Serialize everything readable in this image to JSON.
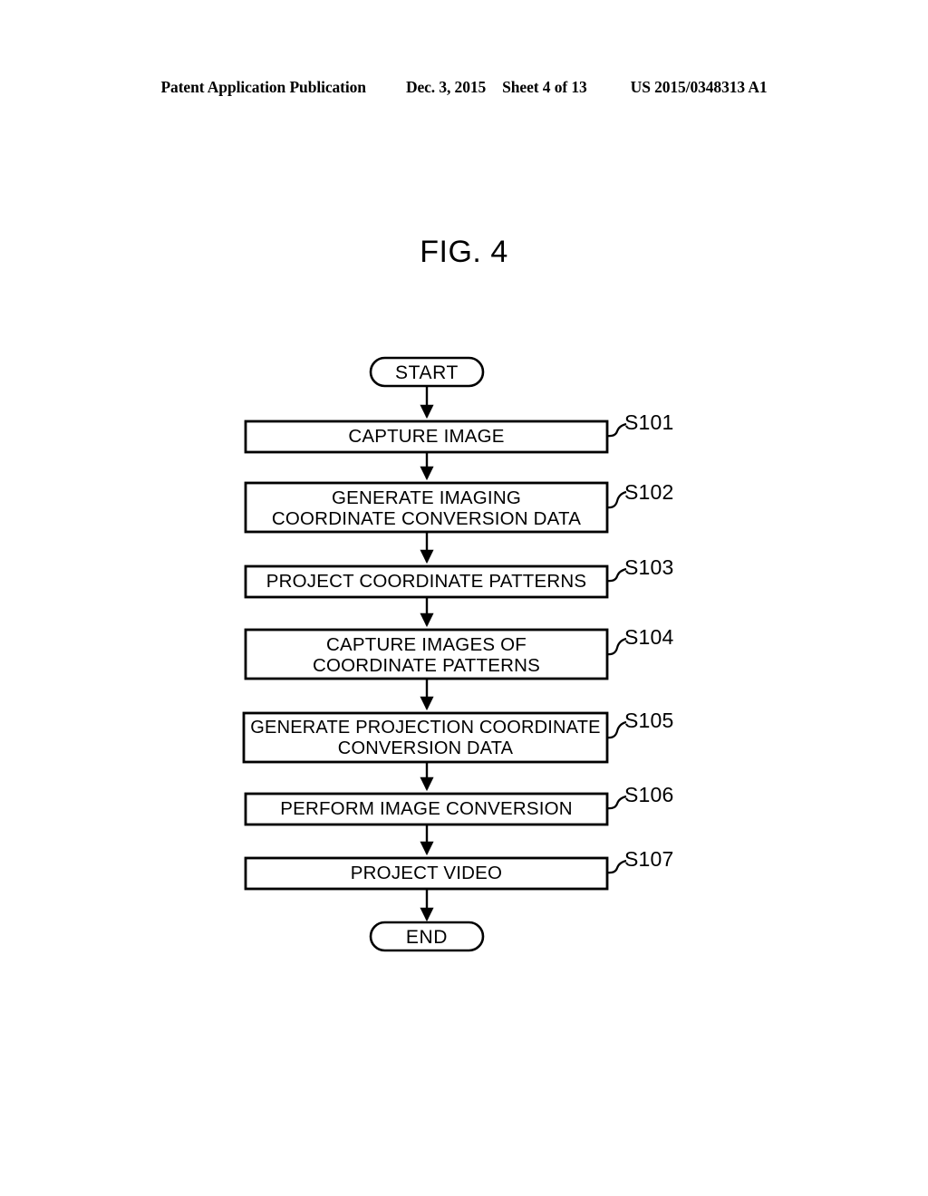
{
  "header": {
    "publication": "Patent Application Publication",
    "date": "Dec. 3, 2015",
    "sheet": "Sheet 4 of 13",
    "patent_number": "US 2015/0348313 A1"
  },
  "figure": {
    "title": "FIG. 4"
  },
  "flowchart": {
    "start_label": "START",
    "end_label": "END",
    "nodes": [
      {
        "ref": "S101",
        "lines": [
          "CAPTURE IMAGE"
        ]
      },
      {
        "ref": "S102",
        "lines": [
          "GENERATE IMAGING",
          "COORDINATE CONVERSION DATA"
        ]
      },
      {
        "ref": "S103",
        "lines": [
          "PROJECT COORDINATE PATTERNS"
        ]
      },
      {
        "ref": "S104",
        "lines": [
          "CAPTURE IMAGES OF",
          "COORDINATE PATTERNS"
        ]
      },
      {
        "ref": "S105",
        "lines": [
          "GENERATE PROJECTION COORDINATE",
          "CONVERSION DATA"
        ]
      },
      {
        "ref": "S106",
        "lines": [
          "PERFORM IMAGE CONVERSION"
        ]
      },
      {
        "ref": "S107",
        "lines": [
          "PROJECT VIDEO"
        ]
      }
    ]
  },
  "colors": {
    "ink": "#000000",
    "paper": "#ffffff"
  }
}
